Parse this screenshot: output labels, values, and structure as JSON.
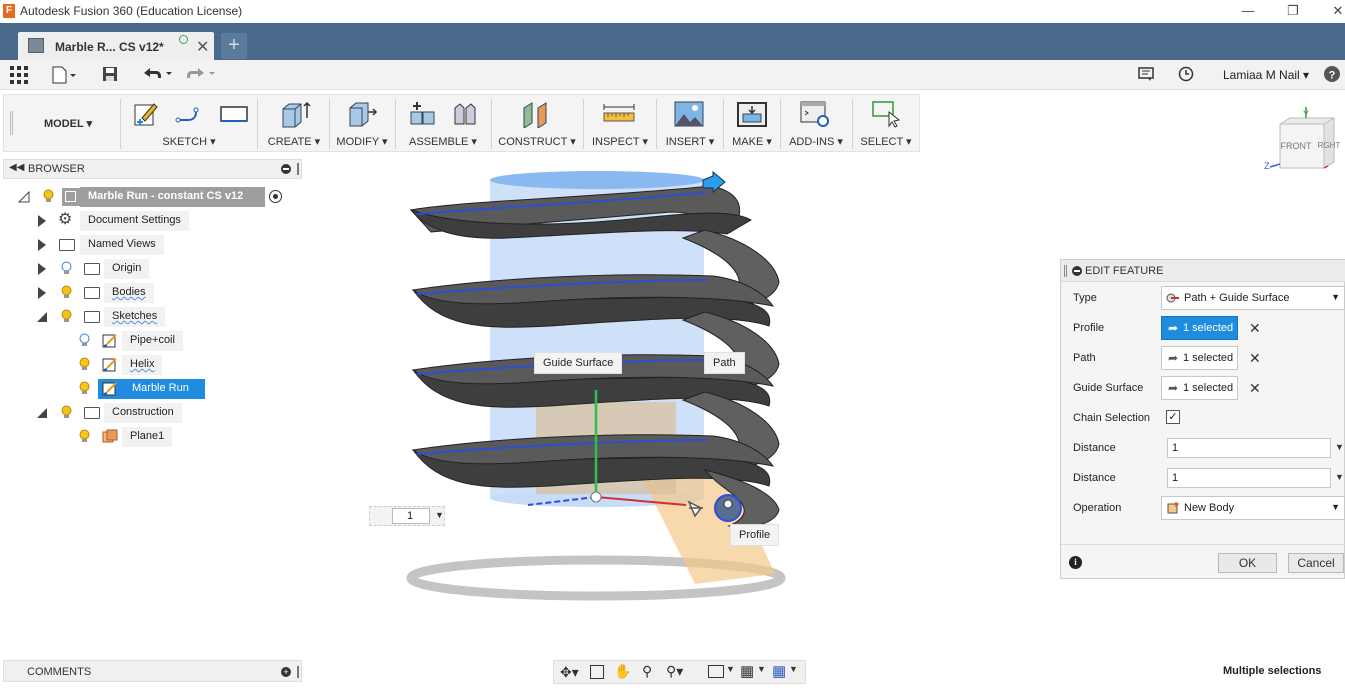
{
  "window": {
    "title": "Autodesk Fusion 360 (Education License)",
    "app_icon": "F"
  },
  "document_tab": {
    "label": "Marble R... CS v12*"
  },
  "quick_access": {
    "user": "Lamiaa M Nail"
  },
  "toolbar": {
    "workspace": "MODEL",
    "groups": [
      {
        "label": "SKETCH"
      },
      {
        "label": "CREATE"
      },
      {
        "label": "MODIFY"
      },
      {
        "label": "ASSEMBLE"
      },
      {
        "label": "CONSTRUCT"
      },
      {
        "label": "INSPECT"
      },
      {
        "label": "INSERT"
      },
      {
        "label": "MAKE"
      },
      {
        "label": "ADD-INS"
      },
      {
        "label": "SELECT"
      }
    ]
  },
  "view_cube": {
    "front": "FRONT",
    "right": "RGHT",
    "x": "X",
    "y": "Y",
    "z": "Z"
  },
  "browser": {
    "title": "BROWSER",
    "root": "Marble Run - constant CS v12",
    "items": [
      {
        "label": "Document Settings"
      },
      {
        "label": "Named Views"
      },
      {
        "label": "Origin"
      },
      {
        "label": "Bodies"
      },
      {
        "label": "Sketches"
      },
      {
        "label": "Pipe+coil"
      },
      {
        "label": "Helix"
      },
      {
        "label": "Marble Run"
      },
      {
        "label": "Construction"
      },
      {
        "label": "Plane1"
      }
    ]
  },
  "canvas": {
    "guide_surface_tag": "Guide Surface",
    "path_tag": "Path",
    "profile_tag": "Profile",
    "distance_input": "1"
  },
  "edit_feature": {
    "title": "EDIT FEATURE",
    "type_label": "Type",
    "type_value": "Path + Guide Surface",
    "profile_label": "Profile",
    "profile_value": "1 selected",
    "path_label": "Path",
    "path_value": "1 selected",
    "guide_label": "Guide Surface",
    "guide_value": "1 selected",
    "chain_label": "Chain Selection",
    "chain_checked": true,
    "distance1_label": "Distance",
    "distance1_value": "1",
    "distance2_label": "Distance",
    "distance2_value": "1",
    "operation_label": "Operation",
    "operation_value": "New Body",
    "ok": "OK",
    "cancel": "Cancel"
  },
  "comments": {
    "title": "COMMENTS"
  },
  "status": {
    "text": "Multiple selections"
  },
  "colors": {
    "accent": "#1f8ce0",
    "tabbar": "#4a6a8c",
    "guide_surface": "#a9c9f5"
  }
}
